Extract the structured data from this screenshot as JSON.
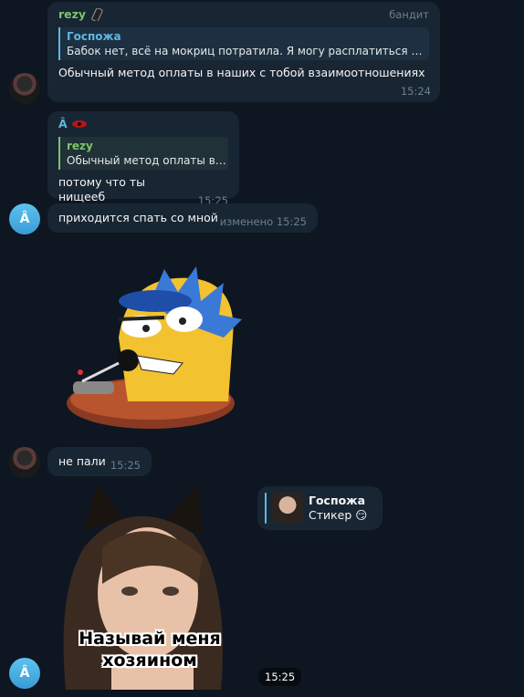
{
  "messages": {
    "m1": {
      "sender": "rezy",
      "role": "бандит",
      "reply_name": "Госпожа",
      "reply_text": "Бабок нет, всё на мокриц потратила. Я могу расплатиться нат...",
      "text": "Обычный метод оплаты в наших с тобой взаимоотношениях",
      "time": "15:24"
    },
    "m2": {
      "sender": "Â",
      "reply_name": "rezy",
      "reply_text": "Обычный метод оплаты в ...",
      "text": "потому что ты нищееб",
      "time": "15:25"
    },
    "m3": {
      "text": "приходится спать со мной",
      "edited": "изменено",
      "time": "15:25"
    },
    "m4": {
      "text": "не пали",
      "time": "15:25"
    },
    "m5": {
      "reply_name": "Госпожа",
      "reply_text": "Стикер 😏",
      "sticker_caption_1": "Называй меня",
      "sticker_caption_2": "хозяином",
      "time": "15:25"
    }
  },
  "avatars": {
    "rezy_initial": "",
    "a_initial": "Â"
  },
  "colors": {
    "background": "#0e1621",
    "bubble": "#182533",
    "green_name": "#7ec36c",
    "teal_name": "#5fb8e0",
    "time": "#6d7f8f"
  }
}
